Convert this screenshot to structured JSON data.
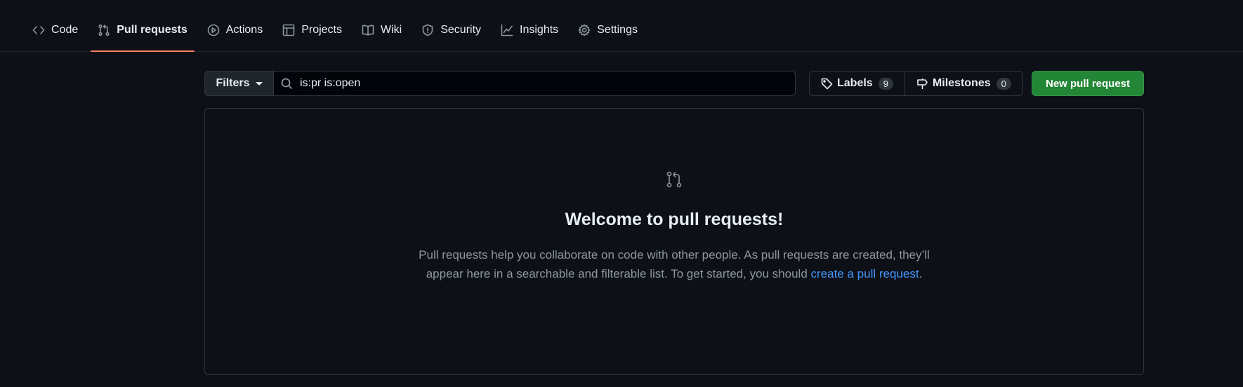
{
  "nav": {
    "items": [
      {
        "label": "Code",
        "icon": "code-icon"
      },
      {
        "label": "Pull requests",
        "icon": "pull-request-icon",
        "selected": true
      },
      {
        "label": "Actions",
        "icon": "play-icon"
      },
      {
        "label": "Projects",
        "icon": "table-icon"
      },
      {
        "label": "Wiki",
        "icon": "book-icon"
      },
      {
        "label": "Security",
        "icon": "shield-icon"
      },
      {
        "label": "Insights",
        "icon": "graph-icon"
      },
      {
        "label": "Settings",
        "icon": "gear-icon"
      }
    ],
    "selected_underline_color": "#f78166"
  },
  "toolbar": {
    "filters_label": "Filters",
    "search_value": "is:pr is:open",
    "labels_label": "Labels",
    "labels_count": "9",
    "milestones_label": "Milestones",
    "milestones_count": "0",
    "new_pr_label": "New pull request",
    "new_pr_color": "#238636"
  },
  "blankslate": {
    "title": "Welcome to pull requests!",
    "text_before": "Pull requests help you collaborate on code with other people. As pull requests are created, they’ll appear here in a searchable and filterable list. To get started, you should ",
    "link_text": "create a pull request",
    "text_after": "."
  },
  "colors": {
    "background": "#0d1117",
    "border": "#30363d",
    "link": "#4493f8"
  }
}
